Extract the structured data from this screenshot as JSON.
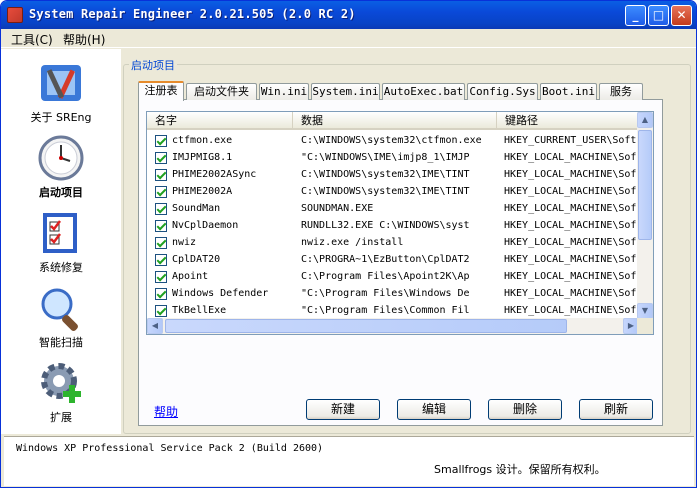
{
  "window": {
    "title": "System Repair Engineer 2.0.21.505 (2.0 RC 2)"
  },
  "menu": [
    {
      "label": "工具(C)"
    },
    {
      "label": "帮助(H)"
    }
  ],
  "sidebar": {
    "items": [
      {
        "label": "关于 SREng",
        "icon": "tools-icon"
      },
      {
        "label": "启动项目",
        "icon": "clock-icon"
      },
      {
        "label": "系统修复",
        "icon": "checklist-icon"
      },
      {
        "label": "智能扫描",
        "icon": "magnifier-icon"
      },
      {
        "label": "扩展",
        "icon": "gear-plus-icon"
      }
    ],
    "active_index": 1
  },
  "group": {
    "title": "启动项目"
  },
  "tabs": [
    "注册表",
    "启动文件夹",
    "Win.ini",
    "System.ini",
    "AutoExec.bat",
    "Config.Sys",
    "Boot.ini",
    "服务"
  ],
  "table": {
    "columns": [
      "名字",
      "数据",
      "键路径"
    ],
    "rows": [
      {
        "name": "ctfmon.exe",
        "data": "C:\\WINDOWS\\system32\\ctfmon.exe",
        "key": "HKEY_CURRENT_USER\\Soft"
      },
      {
        "name": "IMJPMIG8.1",
        "data": "\"C:\\WINDOWS\\IME\\imjp8_1\\IMJP",
        "key": "HKEY_LOCAL_MACHINE\\Sof"
      },
      {
        "name": "PHIME2002ASync",
        "data": "C:\\WINDOWS\\system32\\IME\\TINT",
        "key": "HKEY_LOCAL_MACHINE\\Sof"
      },
      {
        "name": "PHIME2002A",
        "data": "C:\\WINDOWS\\system32\\IME\\TINT",
        "key": "HKEY_LOCAL_MACHINE\\Sof"
      },
      {
        "name": "SoundMan",
        "data": "SOUNDMAN.EXE",
        "key": "HKEY_LOCAL_MACHINE\\Sof"
      },
      {
        "name": "NvCplDaemon",
        "data": "RUNDLL32.EXE C:\\WINDOWS\\syst",
        "key": "HKEY_LOCAL_MACHINE\\Sof"
      },
      {
        "name": "nwiz",
        "data": "nwiz.exe /install",
        "key": "HKEY_LOCAL_MACHINE\\Sof"
      },
      {
        "name": "CplDAT20",
        "data": "C:\\PROGRA~1\\EzButton\\CplDAT2",
        "key": "HKEY_LOCAL_MACHINE\\Sof"
      },
      {
        "name": "Apoint",
        "data": "C:\\Program Files\\Apoint2K\\Ap",
        "key": "HKEY_LOCAL_MACHINE\\Sof"
      },
      {
        "name": "Windows Defender",
        "data": "\"C:\\Program Files\\Windows De",
        "key": "HKEY_LOCAL_MACHINE\\Sof"
      },
      {
        "name": "TkBellExe",
        "data": "\"C:\\Program Files\\Common Fil",
        "key": "HKEY_LOCAL_MACHINE\\Sof"
      }
    ]
  },
  "help_link": "帮助",
  "buttons": {
    "new": "新建",
    "edit": "编辑",
    "delete": "删除",
    "refresh": "刷新"
  },
  "status": {
    "os": "Windows XP Professional Service Pack 2 (Build 2600)",
    "copyright": "Smallfrogs 设计。保留所有权利。"
  }
}
